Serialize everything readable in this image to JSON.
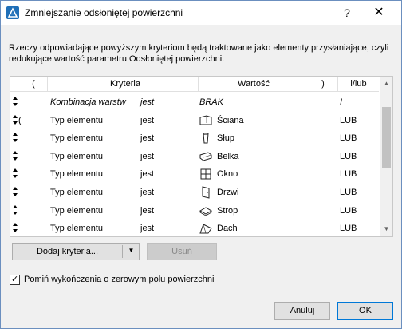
{
  "window": {
    "title": "Zmniejszanie odsłoniętej powierzchni",
    "help_label": "?",
    "close_label": "✕"
  },
  "description": "Rzeczy odpowiadające powyższym kryteriom będą traktowane jako elementy przysłaniające, czyli redukujące wartość parametru Odsłoniętej powierzchni.",
  "table": {
    "headers": {
      "open_paren": "(",
      "criteria": "Kryteria",
      "value": "Wartość",
      "close_paren": ")",
      "and_or": "i/lub"
    },
    "rows": [
      {
        "paren": "",
        "criteria": "Kombinacja warstw",
        "op": "jest",
        "value": "BRAK",
        "icon": "",
        "andor": "I",
        "italic": true
      },
      {
        "paren": "(",
        "criteria": "Typ elementu",
        "op": "jest",
        "value": "Ściana",
        "icon": "wall-icon",
        "andor": "LUB",
        "italic": false
      },
      {
        "paren": "",
        "criteria": "Typ elementu",
        "op": "jest",
        "value": "Słup",
        "icon": "column-icon",
        "andor": "LUB",
        "italic": false
      },
      {
        "paren": "",
        "criteria": "Typ elementu",
        "op": "jest",
        "value": "Belka",
        "icon": "beam-icon",
        "andor": "LUB",
        "italic": false
      },
      {
        "paren": "",
        "criteria": "Typ elementu",
        "op": "jest",
        "value": "Okno",
        "icon": "window-icon",
        "andor": "LUB",
        "italic": false
      },
      {
        "paren": "",
        "criteria": "Typ elementu",
        "op": "jest",
        "value": "Drzwi",
        "icon": "door-icon",
        "andor": "LUB",
        "italic": false
      },
      {
        "paren": "",
        "criteria": "Typ elementu",
        "op": "jest",
        "value": "Strop",
        "icon": "slab-icon",
        "andor": "LUB",
        "italic": false
      },
      {
        "paren": "",
        "criteria": "Typ elementu",
        "op": "jest",
        "value": "Dach",
        "icon": "roof-icon",
        "andor": "LUB",
        "italic": false
      }
    ]
  },
  "buttons": {
    "add_criteria": "Dodaj kryteria...",
    "remove": "Usuń",
    "cancel": "Anuluj",
    "ok": "OK"
  },
  "checkbox": {
    "label": "Pomiń wykończenia o zerowym polu powierzchni",
    "checked": true
  },
  "colors": {
    "accent": "#0078d7",
    "window_border": "#6b8fbf",
    "disabled_button": "#cccccc"
  }
}
